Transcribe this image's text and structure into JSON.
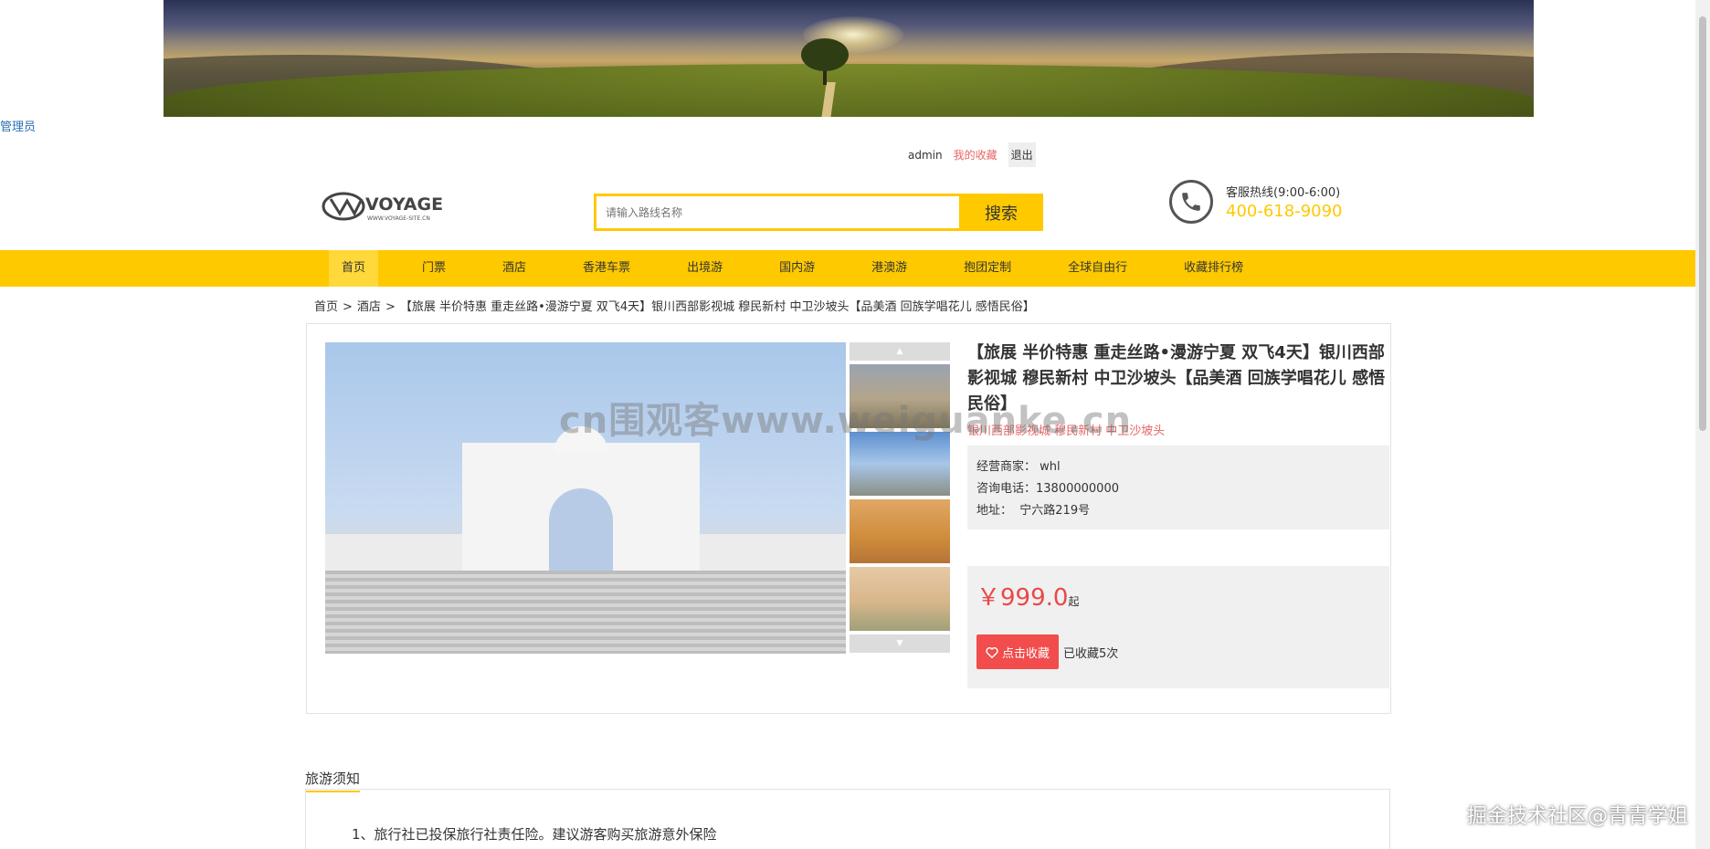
{
  "header": {
    "admin_link": "管理员",
    "user": "admin",
    "favorites_link": "我的收藏",
    "logout": "退出",
    "logo_text": "VOYAGE",
    "logo_subtext": "WWW.VOYAGE-SITE.CN"
  },
  "search": {
    "placeholder": "请输入路线名称",
    "button_label": "搜索"
  },
  "hotline": {
    "label": "客服热线(9:00-6:00)",
    "number": "400-618-9090"
  },
  "nav": {
    "items": [
      "首页",
      "门票",
      "酒店",
      "香港车票",
      "出境游",
      "国内游",
      "港澳游",
      "抱团定制",
      "全球自由行",
      "收藏排行榜"
    ]
  },
  "breadcrumb": {
    "home": "首页",
    "category": "酒店",
    "sep": ">",
    "current": "【旅展 半价特惠 重走丝路•漫游宁夏 双飞4天】银川西部影视城 穆民新村 中卫沙坡头【品美酒 回族学唱花儿 感悟民俗】"
  },
  "product": {
    "title": "【旅展 半价特惠 重走丝路•漫游宁夏 双飞4天】银川西部影视城 穆民新村 中卫沙坡头【品美酒 回族学唱花儿 感悟民俗】",
    "subtitle": "银川西部影视城 穆民新村 中卫沙坡头",
    "merchant_label": "经营商家：",
    "merchant": "whl",
    "phone_label": "咨询电话：",
    "phone": "13800000000",
    "address_label": "地址：",
    "address": "宁六路219号",
    "price": "￥999.0",
    "price_suffix": "起",
    "favorite_button": "点击收藏",
    "favorite_count": "已收藏5次"
  },
  "notice": {
    "title": "旅游须知",
    "items": [
      "1、旅行社已投保旅行社责任险。建议游客购买旅游意外保险"
    ]
  },
  "watermarks": {
    "center": "cn围观客www.weiguanke.cn",
    "corner": "掘金技术社区@青青学姐"
  },
  "colors": {
    "accent": "#ffc900",
    "price": "#e94848",
    "link_red": "#e96565",
    "favorite_button": "#f24c4c"
  }
}
